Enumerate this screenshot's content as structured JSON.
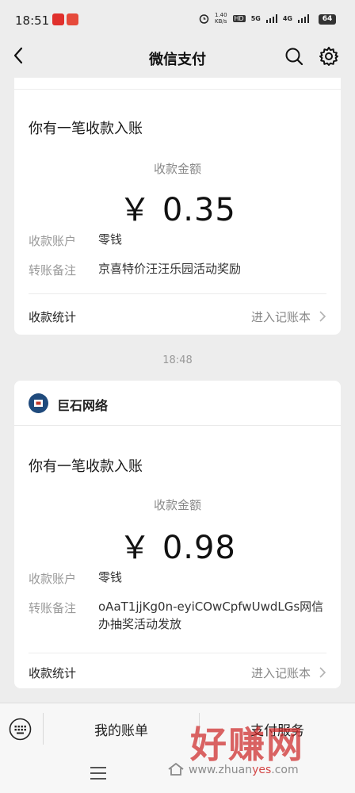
{
  "status_bar": {
    "time": "18:51",
    "net_speed_value": "1.40",
    "net_speed_unit": "KB/s",
    "hd": "HD",
    "net_5g": "5G",
    "net_4g": "4G",
    "battery": "64"
  },
  "nav": {
    "title": "微信支付"
  },
  "cards": [
    {
      "notice": "你有一笔收款入账",
      "amount_label": "收款金额",
      "amount": "￥ 0.35",
      "account_label": "收款账户",
      "account_value": "零钱",
      "remark_label": "转账备注",
      "remark_value": "京喜特价汪汪乐园活动奖励",
      "stats_label": "收款统计",
      "stats_link": "进入记账本"
    },
    {
      "merchant": "巨石网络",
      "notice": "你有一笔收款入账",
      "amount_label": "收款金额",
      "amount": "￥ 0.98",
      "account_label": "收款账户",
      "account_value": "零钱",
      "remark_label": "转账备注",
      "remark_value": "oAaT1jjKg0n-eyiCOwCpfwUwdLGs网信办抽奖活动发放",
      "stats_label": "收款统计",
      "stats_link": "进入记账本"
    }
  ],
  "timestamp": "18:48",
  "bottom_bar": {
    "bill_label": "我的账单",
    "service_label": "支付服务"
  },
  "watermark": {
    "big": "好赚网",
    "site_prefix": "www.zhuan",
    "site_highlight": "yes",
    "site_suffix": ".com"
  },
  "colors": {
    "background": "#ededed",
    "card": "#ffffff",
    "watermark_red": "#cd2828"
  },
  "icons": [
    "back-icon",
    "search-icon",
    "gear-icon",
    "chevron-right-icon",
    "keyboard-icon",
    "menu-icon",
    "home-icon"
  ]
}
